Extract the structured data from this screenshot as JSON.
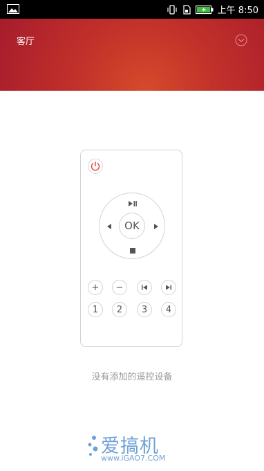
{
  "status_bar": {
    "time": "上午 8:50",
    "icons": [
      "image-icon",
      "vibrate-icon",
      "sim-icon",
      "battery-icon"
    ]
  },
  "header": {
    "room_name": "客厅",
    "dropdown_icon": "chevron-down-circle-icon",
    "gradient_colors": [
      "#d64a2b",
      "#c1302a",
      "#a61c2c"
    ]
  },
  "remote": {
    "power_icon": "power-icon",
    "play_pause_icon": "play-pause-icon",
    "ok_label": "OK",
    "stop_icon": "stop-icon",
    "left_icon": "arrow-left-icon",
    "right_icon": "arrow-right-icon",
    "function_buttons": [
      "+",
      "−"
    ],
    "skip_icons": [
      "skip-previous-icon",
      "skip-next-icon"
    ],
    "number_buttons": [
      "1",
      "2",
      "3",
      "4"
    ]
  },
  "empty_message": "没有添加的遥控设备",
  "watermark": {
    "brand": "爱搞机",
    "url": "www.iGAO7.COM"
  },
  "accent_color": "#e04a4a"
}
